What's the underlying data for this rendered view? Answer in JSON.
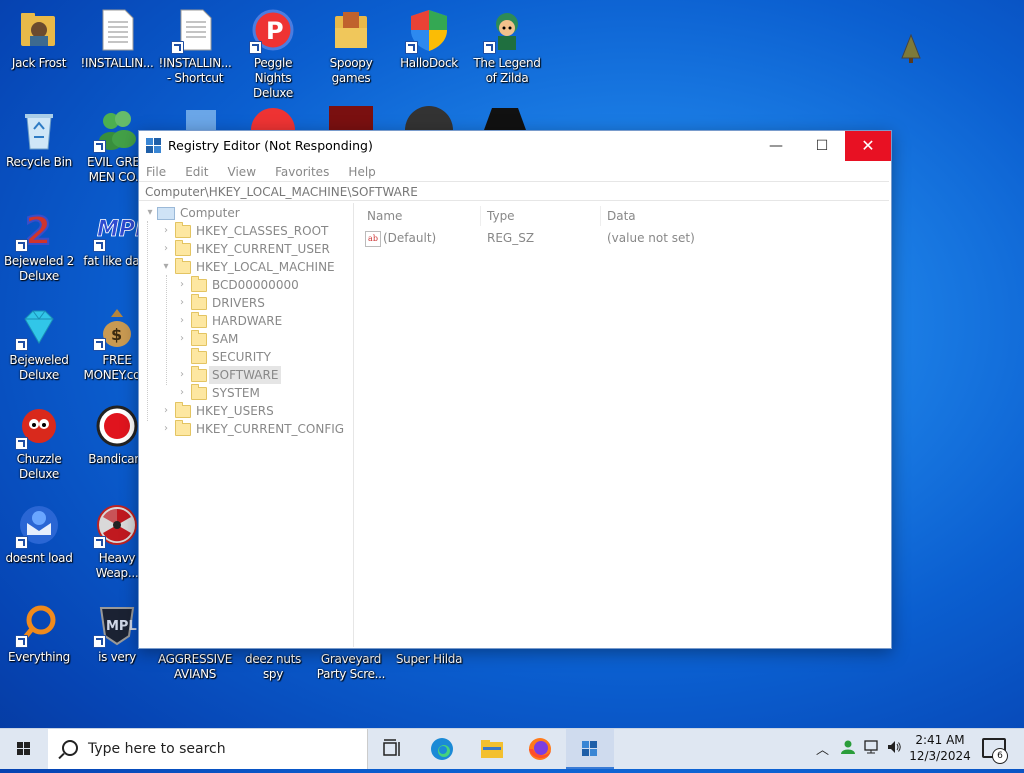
{
  "desktop": {
    "icons": [
      {
        "label": "Jack Frost"
      },
      {
        "label": "!INSTALLIN..."
      },
      {
        "label": "!INSTALLIN... - Shortcut"
      },
      {
        "label": "Peggle Nights Deluxe"
      },
      {
        "label": "Spoopy games"
      },
      {
        "label": "HalloDock"
      },
      {
        "label": "The Legend of Zilda"
      },
      {
        "label": "Recycle Bin"
      },
      {
        "label": "EVIL GREE MEN CO..."
      },
      {
        "label": "Bejeweled 2 Deluxe"
      },
      {
        "label": "fat like dark"
      },
      {
        "label": "Bejeweled Deluxe"
      },
      {
        "label": "FREE MONEY.co..."
      },
      {
        "label": "Chuzzle Deluxe"
      },
      {
        "label": "Bandicam"
      },
      {
        "label": "doesnt load"
      },
      {
        "label": "Heavy Weap..."
      },
      {
        "label": "Everything"
      },
      {
        "label": "is very"
      },
      {
        "label": "AGGRESSIVE AVIANS"
      },
      {
        "label": "deez nuts spy"
      },
      {
        "label": "Graveyard Party Scre..."
      },
      {
        "label": "Super Hilda"
      }
    ]
  },
  "window": {
    "title": "Registry Editor (Not Responding)",
    "controls": {
      "minimize": "—",
      "maximize": "☐",
      "close": "✕"
    },
    "menu": [
      "File",
      "Edit",
      "View",
      "Favorites",
      "Help"
    ],
    "address": "Computer\\HKEY_LOCAL_MACHINE\\SOFTWARE",
    "tree": {
      "root": "Computer",
      "hives": [
        "HKEY_CLASSES_ROOT",
        "HKEY_CURRENT_USER",
        "HKEY_LOCAL_MACHINE",
        "HKEY_USERS",
        "HKEY_CURRENT_CONFIG"
      ],
      "hklm_children": [
        "BCD00000000",
        "DRIVERS",
        "HARDWARE",
        "SAM",
        "SECURITY",
        "SOFTWARE",
        "SYSTEM"
      ],
      "selected": "SOFTWARE"
    },
    "list": {
      "columns": [
        "Name",
        "Type",
        "Data"
      ],
      "rows": [
        {
          "name": "(Default)",
          "type": "REG_SZ",
          "data": "(value not set)",
          "icon": "ab-string-icon"
        }
      ]
    }
  },
  "taskbar": {
    "search_placeholder": "Type here to search",
    "time": "2:41 AM",
    "date": "12/3/2024",
    "notification_count": "6"
  },
  "colors": {
    "desktop_blue": "#0b5fd0",
    "close_red": "#e81123",
    "taskbar": "#dfe7f2"
  }
}
